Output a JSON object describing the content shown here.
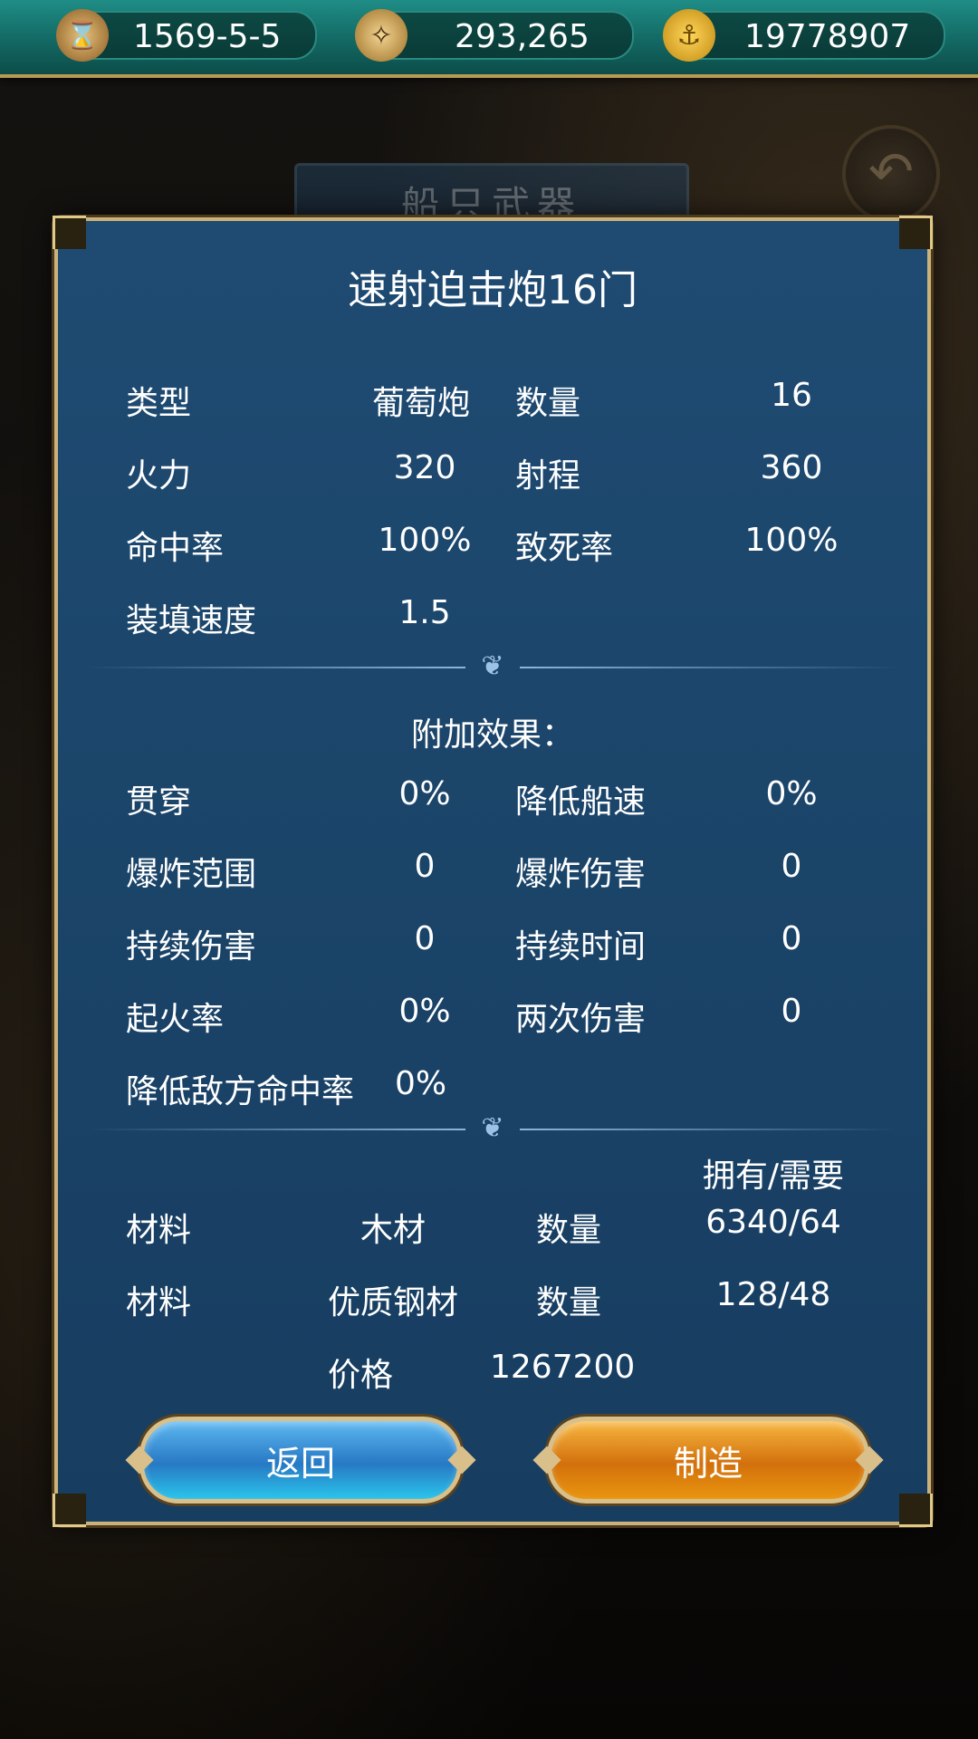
{
  "topbar": {
    "date": "1569-5-5",
    "reputation": "293,265",
    "gold": "19778907",
    "icons": [
      "hourglass-icon",
      "compass-icon",
      "gold-coin-icon"
    ]
  },
  "background": {
    "title": "船只武器"
  },
  "dialog": {
    "title": "速射迫击炮16门",
    "stats": {
      "type_label": "类型",
      "type_value": "葡萄炮",
      "count_label": "数量",
      "count_value": "16",
      "firepower_label": "火力",
      "firepower_value": "320",
      "range_label": "射程",
      "range_value": "360",
      "hit_label": "命中率",
      "hit_value": "100%",
      "lethal_label": "致死率",
      "lethal_value": "100%",
      "reload_label": "装填速度",
      "reload_value": "1.5"
    },
    "effects": {
      "heading": "附加效果：",
      "pierce_label": "贯穿",
      "pierce_value": "0%",
      "slow_label": "降低船速",
      "slow_value": "0%",
      "blast_range_label": "爆炸范围",
      "blast_range_value": "0",
      "blast_dmg_label": "爆炸伤害",
      "blast_dmg_value": "0",
      "dot_label": "持续伤害",
      "dot_value": "0",
      "duration_label": "持续时间",
      "duration_value": "0",
      "fire_label": "起火率",
      "fire_value": "0%",
      "double_label": "两次伤害",
      "double_value": "0",
      "reduce_hit_label": "降低敌方命中率",
      "reduce_hit_value": "0%"
    },
    "materials": {
      "header": "拥有/需要",
      "rows": [
        {
          "label": "材料",
          "name": "木材",
          "qty_label": "数量",
          "qty": "6340/64"
        },
        {
          "label": "材料",
          "name": "优质钢材",
          "qty_label": "数量",
          "qty": "128/48"
        }
      ],
      "price_label": "价格",
      "price_value": "1267200"
    },
    "buttons": {
      "back": "返回",
      "make": "制造"
    }
  },
  "colors": {
    "panel": "#1f4b72",
    "border_gold": "#cbb27a",
    "back_button": "#2779c4",
    "make_button": "#d2700c"
  }
}
